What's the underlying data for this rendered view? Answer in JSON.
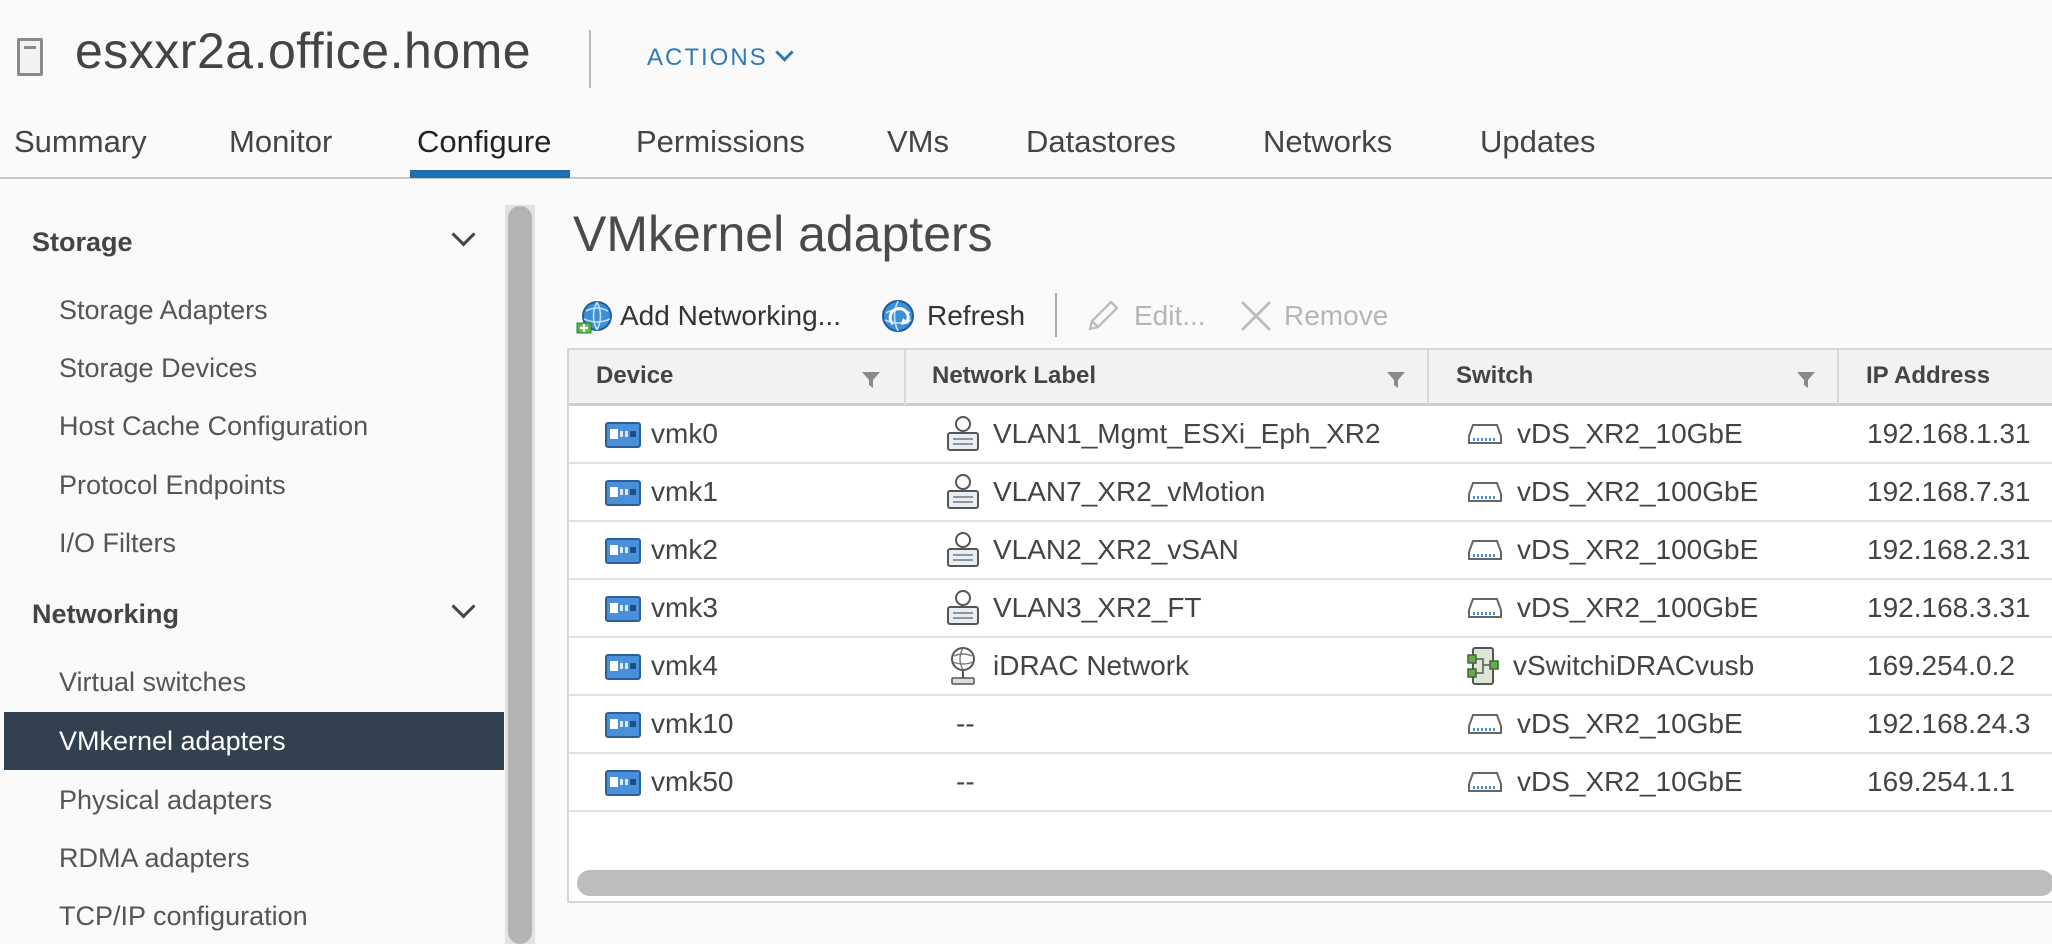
{
  "header": {
    "host_name": "esxxr2a.office.home",
    "actions_label": "ACTIONS"
  },
  "tabs": [
    {
      "label": "Summary"
    },
    {
      "label": "Monitor"
    },
    {
      "label": "Configure",
      "active": true
    },
    {
      "label": "Permissions"
    },
    {
      "label": "VMs"
    },
    {
      "label": "Datastores"
    },
    {
      "label": "Networks"
    },
    {
      "label": "Updates"
    }
  ],
  "sidebar": {
    "storage": {
      "title": "Storage",
      "items": [
        "Storage Adapters",
        "Storage Devices",
        "Host Cache Configuration",
        "Protocol Endpoints",
        "I/O Filters"
      ]
    },
    "networking": {
      "title": "Networking",
      "items": [
        "Virtual switches",
        "VMkernel adapters",
        "Physical adapters",
        "RDMA adapters",
        "TCP/IP configuration"
      ],
      "selected": "VMkernel adapters"
    }
  },
  "main": {
    "title": "VMkernel adapters",
    "toolbar": {
      "add_networking": "Add Networking...",
      "refresh": "Refresh",
      "edit": "Edit...",
      "remove": "Remove"
    }
  },
  "grid": {
    "columns": [
      "Device",
      "Network Label",
      "Switch",
      "IP Address"
    ],
    "rows": [
      {
        "device": "vmk0",
        "network_label": "VLAN1_Mgmt_ESXi_Eph_XR2",
        "network_icon": "distributed-portgroup-icon",
        "switch": "vDS_XR2_10GbE",
        "switch_icon": "distributed-switch-icon",
        "ip": "192.168.1.31"
      },
      {
        "device": "vmk1",
        "network_label": "VLAN7_XR2_vMotion",
        "network_icon": "distributed-portgroup-icon",
        "switch": "vDS_XR2_100GbE",
        "switch_icon": "distributed-switch-icon",
        "ip": "192.168.7.31"
      },
      {
        "device": "vmk2",
        "network_label": "VLAN2_XR2_vSAN",
        "network_icon": "distributed-portgroup-icon",
        "switch": "vDS_XR2_100GbE",
        "switch_icon": "distributed-switch-icon",
        "ip": "192.168.2.31"
      },
      {
        "device": "vmk3",
        "network_label": "VLAN3_XR2_FT",
        "network_icon": "distributed-portgroup-icon",
        "switch": "vDS_XR2_100GbE",
        "switch_icon": "distributed-switch-icon",
        "ip": "192.168.3.31"
      },
      {
        "device": "vmk4",
        "network_label": "iDRAC Network",
        "network_icon": "standard-network-icon",
        "switch": "vSwitchiDRACvusb",
        "switch_icon": "standard-switch-icon",
        "ip": "169.254.0.2"
      },
      {
        "device": "vmk10",
        "network_label": "--",
        "network_icon": "",
        "switch": "vDS_XR2_10GbE",
        "switch_icon": "distributed-switch-icon",
        "ip": "192.168.24.3"
      },
      {
        "device": "vmk50",
        "network_label": "--",
        "network_icon": "",
        "switch": "vDS_XR2_10GbE",
        "switch_icon": "distributed-switch-icon",
        "ip": "169.254.1.1"
      }
    ]
  },
  "colors": {
    "accent": "#1d6fb3",
    "link": "#2c7bb6",
    "sidebar_selected": "#314150"
  }
}
